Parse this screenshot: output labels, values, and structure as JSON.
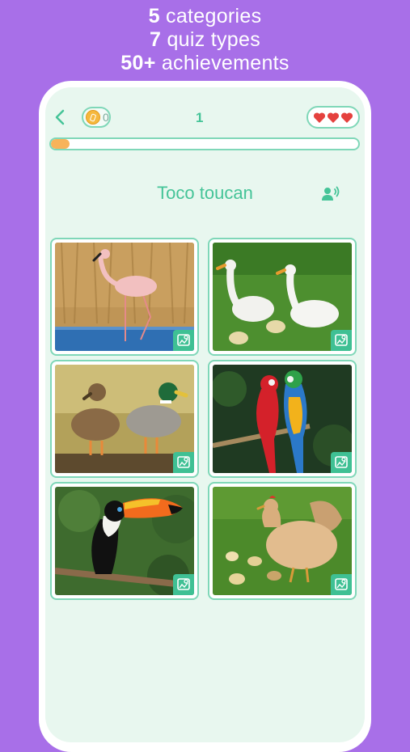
{
  "promo": {
    "line1": {
      "number": "5",
      "text": " categories"
    },
    "line2": {
      "number": "7",
      "text": " quiz types"
    },
    "line3": {
      "number": "50+",
      "text": " achievements"
    }
  },
  "header": {
    "coins": "0",
    "level": "1",
    "lives": 3
  },
  "progress": 0.06,
  "question": {
    "title": "Toco toucan",
    "speaker_icon": "speaker-icon"
  },
  "tiles": [
    {
      "subject": "flamingo"
    },
    {
      "subject": "geese"
    },
    {
      "subject": "ducks"
    },
    {
      "subject": "macaws"
    },
    {
      "subject": "toucan"
    },
    {
      "subject": "hen"
    }
  ],
  "colors": {
    "background": "#a86fe8",
    "accent": "#45c498",
    "heart": "#e5413e",
    "progress": "#f7b35a"
  }
}
